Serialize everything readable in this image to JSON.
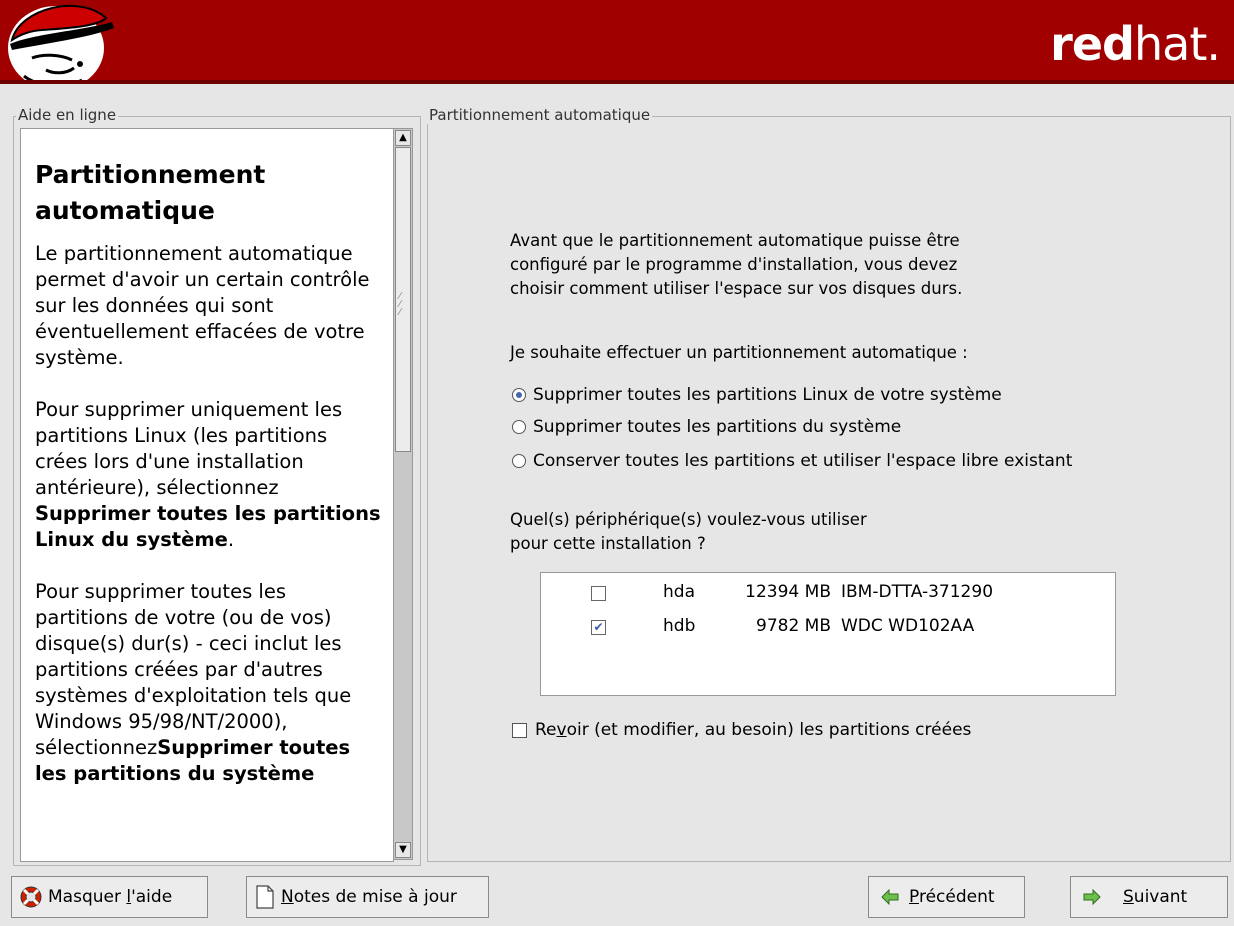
{
  "header": {
    "brand_bold": "red",
    "brand_light": "hat."
  },
  "help_panel": {
    "frame_label": "Aide en ligne",
    "title": "Partitionnement automatique",
    "p1": "Le partitionnement automatique permet d'avoir un certain contrôle sur les données qui sont éventuellement effacées de votre système.",
    "p2_text": "Pour supprimer uniquement les partitions Linux (les partitions crées lors d'une installation antérieure), sélectionnez ",
    "p2_bold": "Supprimer toutes les partitions Linux du système",
    "p2_end": ".",
    "p3_text": "Pour supprimer toutes les partitions de votre (ou de vos) disque(s) dur(s) - ceci inclut les partitions créées par d'autres systèmes d'exploitation tels que Windows 95/98/NT/2000), sélectionnez",
    "p3_bold": "Supprimer toutes les partitions du système"
  },
  "main_panel": {
    "frame_label": "Partitionnement automatique",
    "intro_line1": "Avant que le partitionnement automatique puisse être",
    "intro_line2": "configuré par le programme d'installation, vous devez",
    "intro_line3": "choisir comment utiliser l'espace sur vos disques durs.",
    "question": "Je souhaite effectuer un partitionnement automatique :",
    "options": [
      {
        "label": "Supprimer toutes les partitions Linux de votre système",
        "selected": true
      },
      {
        "label": "Supprimer toutes les partitions du système",
        "selected": false
      },
      {
        "label": "Conserver toutes les partitions et utiliser l'espace libre existant",
        "selected": false
      }
    ],
    "devices_question_line1": "Quel(s) périphérique(s) voulez-vous utiliser",
    "devices_question_line2": "pour cette installation ?",
    "devices": [
      {
        "checked": false,
        "name": "hda",
        "size": "12394 MB",
        "model": "IBM-DTTA-371290"
      },
      {
        "checked": true,
        "name": "hdb",
        "size": "9782 MB",
        "model": "WDC WD102AA"
      }
    ],
    "review_pre": "Re",
    "review_mnemonic": "v",
    "review_post": "oir (et modifier, au besoin) les partitions créées",
    "review_checked": false
  },
  "buttons": {
    "hide_help_pre": "Masquer ",
    "hide_help_mnemonic": "l",
    "hide_help_post": "'aide",
    "release_notes_mnemonic": "N",
    "release_notes_post": "otes de mise à jour",
    "back_mnemonic": "P",
    "back_post": "récédent",
    "next_mnemonic": "S",
    "next_post": "uivant"
  }
}
